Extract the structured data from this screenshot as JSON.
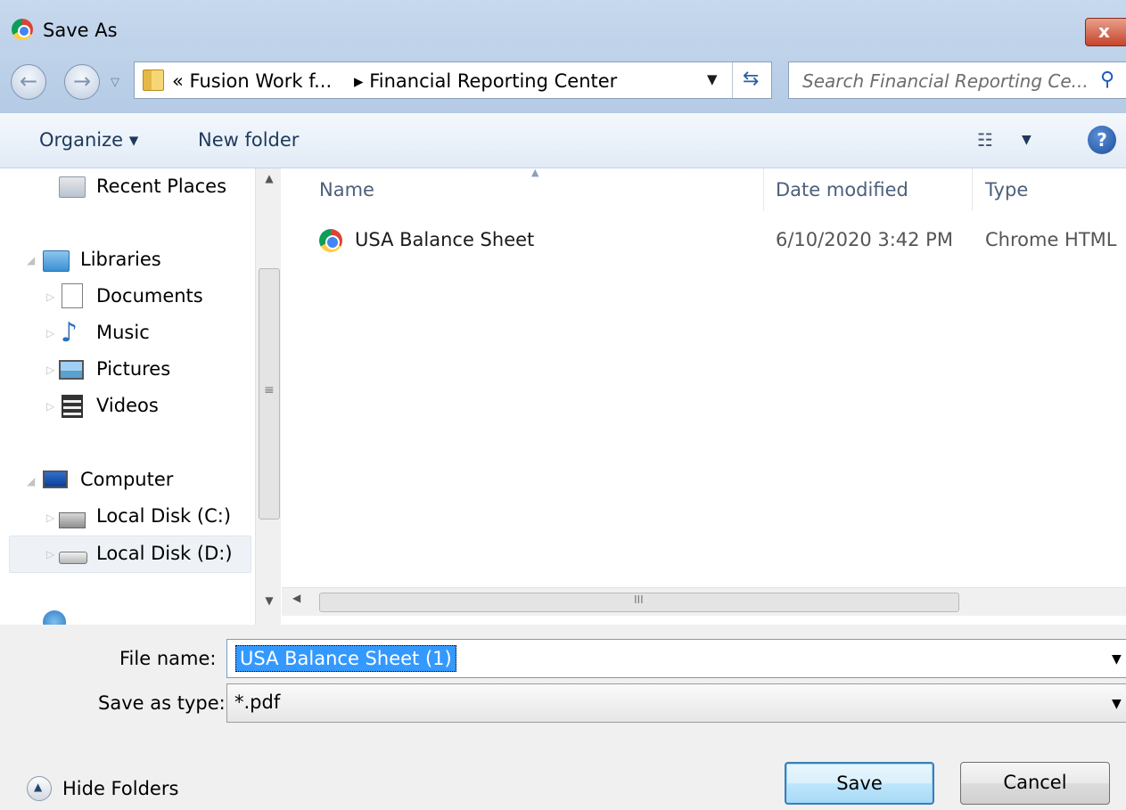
{
  "window": {
    "title": "Save As",
    "close_label": "x"
  },
  "navigation": {
    "back_glyph": "←",
    "forward_glyph": "→",
    "breadcrumb": [
      {
        "label": "« Fusion Work f..."
      },
      {
        "label": "▸ Financial Reporting Center"
      }
    ],
    "search_placeholder": "Search Financial Reporting Ce..."
  },
  "toolbar": {
    "organize_label": "Organize ▾",
    "new_folder_label": "New folder"
  },
  "sidebar": {
    "items": [
      {
        "label": "Recent Places",
        "icon": "recent-places-icon"
      },
      {
        "label": "Libraries",
        "icon": "libraries-icon"
      },
      {
        "label": "Documents",
        "icon": "documents-icon"
      },
      {
        "label": "Music",
        "icon": "music-icon"
      },
      {
        "label": "Pictures",
        "icon": "pictures-icon"
      },
      {
        "label": "Videos",
        "icon": "videos-icon"
      },
      {
        "label": "Computer",
        "icon": "computer-icon"
      },
      {
        "label": "Local Disk (C:)",
        "icon": "local-disk-c-icon"
      },
      {
        "label": "Local Disk (D:)",
        "icon": "local-disk-d-icon",
        "selected": true
      }
    ]
  },
  "file_list": {
    "columns": [
      "Name",
      "Date modified",
      "Type"
    ],
    "rows": [
      {
        "name": "USA Balance Sheet",
        "date_modified": "6/10/2020 3:42 PM",
        "type": "Chrome HTML"
      }
    ]
  },
  "form": {
    "file_name_label": "File name:",
    "file_name_value": "USA Balance Sheet (1)",
    "save_type_label": "Save as type:",
    "save_type_value": "*.pdf"
  },
  "footer": {
    "hide_folders_label": "Hide Folders",
    "save_label": "Save",
    "cancel_label": "Cancel"
  },
  "colors": {
    "title_bar": "#c7d9ee",
    "selection": "#3399ff",
    "primary_button_border": "#3c7fb1"
  }
}
